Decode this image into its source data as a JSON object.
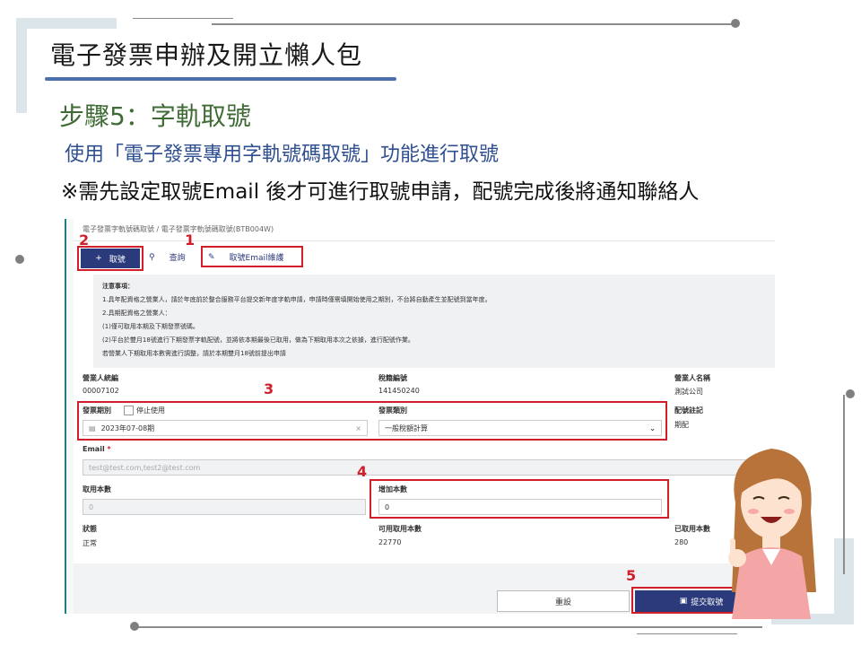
{
  "slide": {
    "title": "電子發票申辦及開立懶人包",
    "step": "步驟5：字軌取號",
    "line1": "使用「電子發票專用字軌號碼取號」功能進行取號",
    "line2": "※需先設定取號Email 後才可進行取號申請，配號完成後將通知聯絡人"
  },
  "screen": {
    "breadcrumb": "電子發票字軌號碼取號 / 電子發票字軌號碼取號(BTB004W)",
    "toolbar": {
      "add": "取號",
      "query": "查詢",
      "email": "取號Email維護"
    },
    "notice": [
      "注意事項：",
      "1.具年配資格之營業人，請於年底前於整合服務平台提交新年度字軌申請，申請時僅需填開始使用之期別，不台將自動產生並配號到當年度。",
      "2.具期配資格之營業人：",
      "(1)僅可取用本期及下期發票號碼。",
      "(2)平台於雙月18號進行下期發票字軌配號，並將依本期最後已取用，做為下期取用本次之依據，進行配號作業。",
      "若營業人下期取用本數需進行調整，請於本期雙月18號前提出申請"
    ],
    "fields": {
      "biz_id_label": "營業人統編",
      "biz_id": "00007102",
      "tax_id_label": "稅籍編號",
      "tax_id": "141450240",
      "biz_name_label": "營業人名稱",
      "biz_name": "測試公司",
      "period_label": "發票期別",
      "stop_label": "停止使用",
      "period_value": "2023年07-08期",
      "type_label": "發票類別",
      "type_value": "一般稅額計算",
      "note_label": "配號註記",
      "note_value": "期配",
      "email_label": "Email",
      "email_placeholder": "test@test.com,test2@test.com",
      "take_label": "取用本數",
      "take_value": "0",
      "add_label": "增加本數",
      "add_value": "0",
      "status_label": "狀態",
      "status_value": "正常",
      "avail_label": "可用取用本數",
      "avail_value": "22770",
      "taken_label": "已取用本數",
      "taken_value": "280"
    },
    "buttons": {
      "reset": "重設",
      "submit": "提交取號"
    },
    "markers": [
      "1",
      "2",
      "3",
      "4",
      "5"
    ]
  },
  "colors": {
    "accent": "#2b3a7a",
    "highlight": "#d11f2a",
    "title_bar": "#4d6fad"
  }
}
